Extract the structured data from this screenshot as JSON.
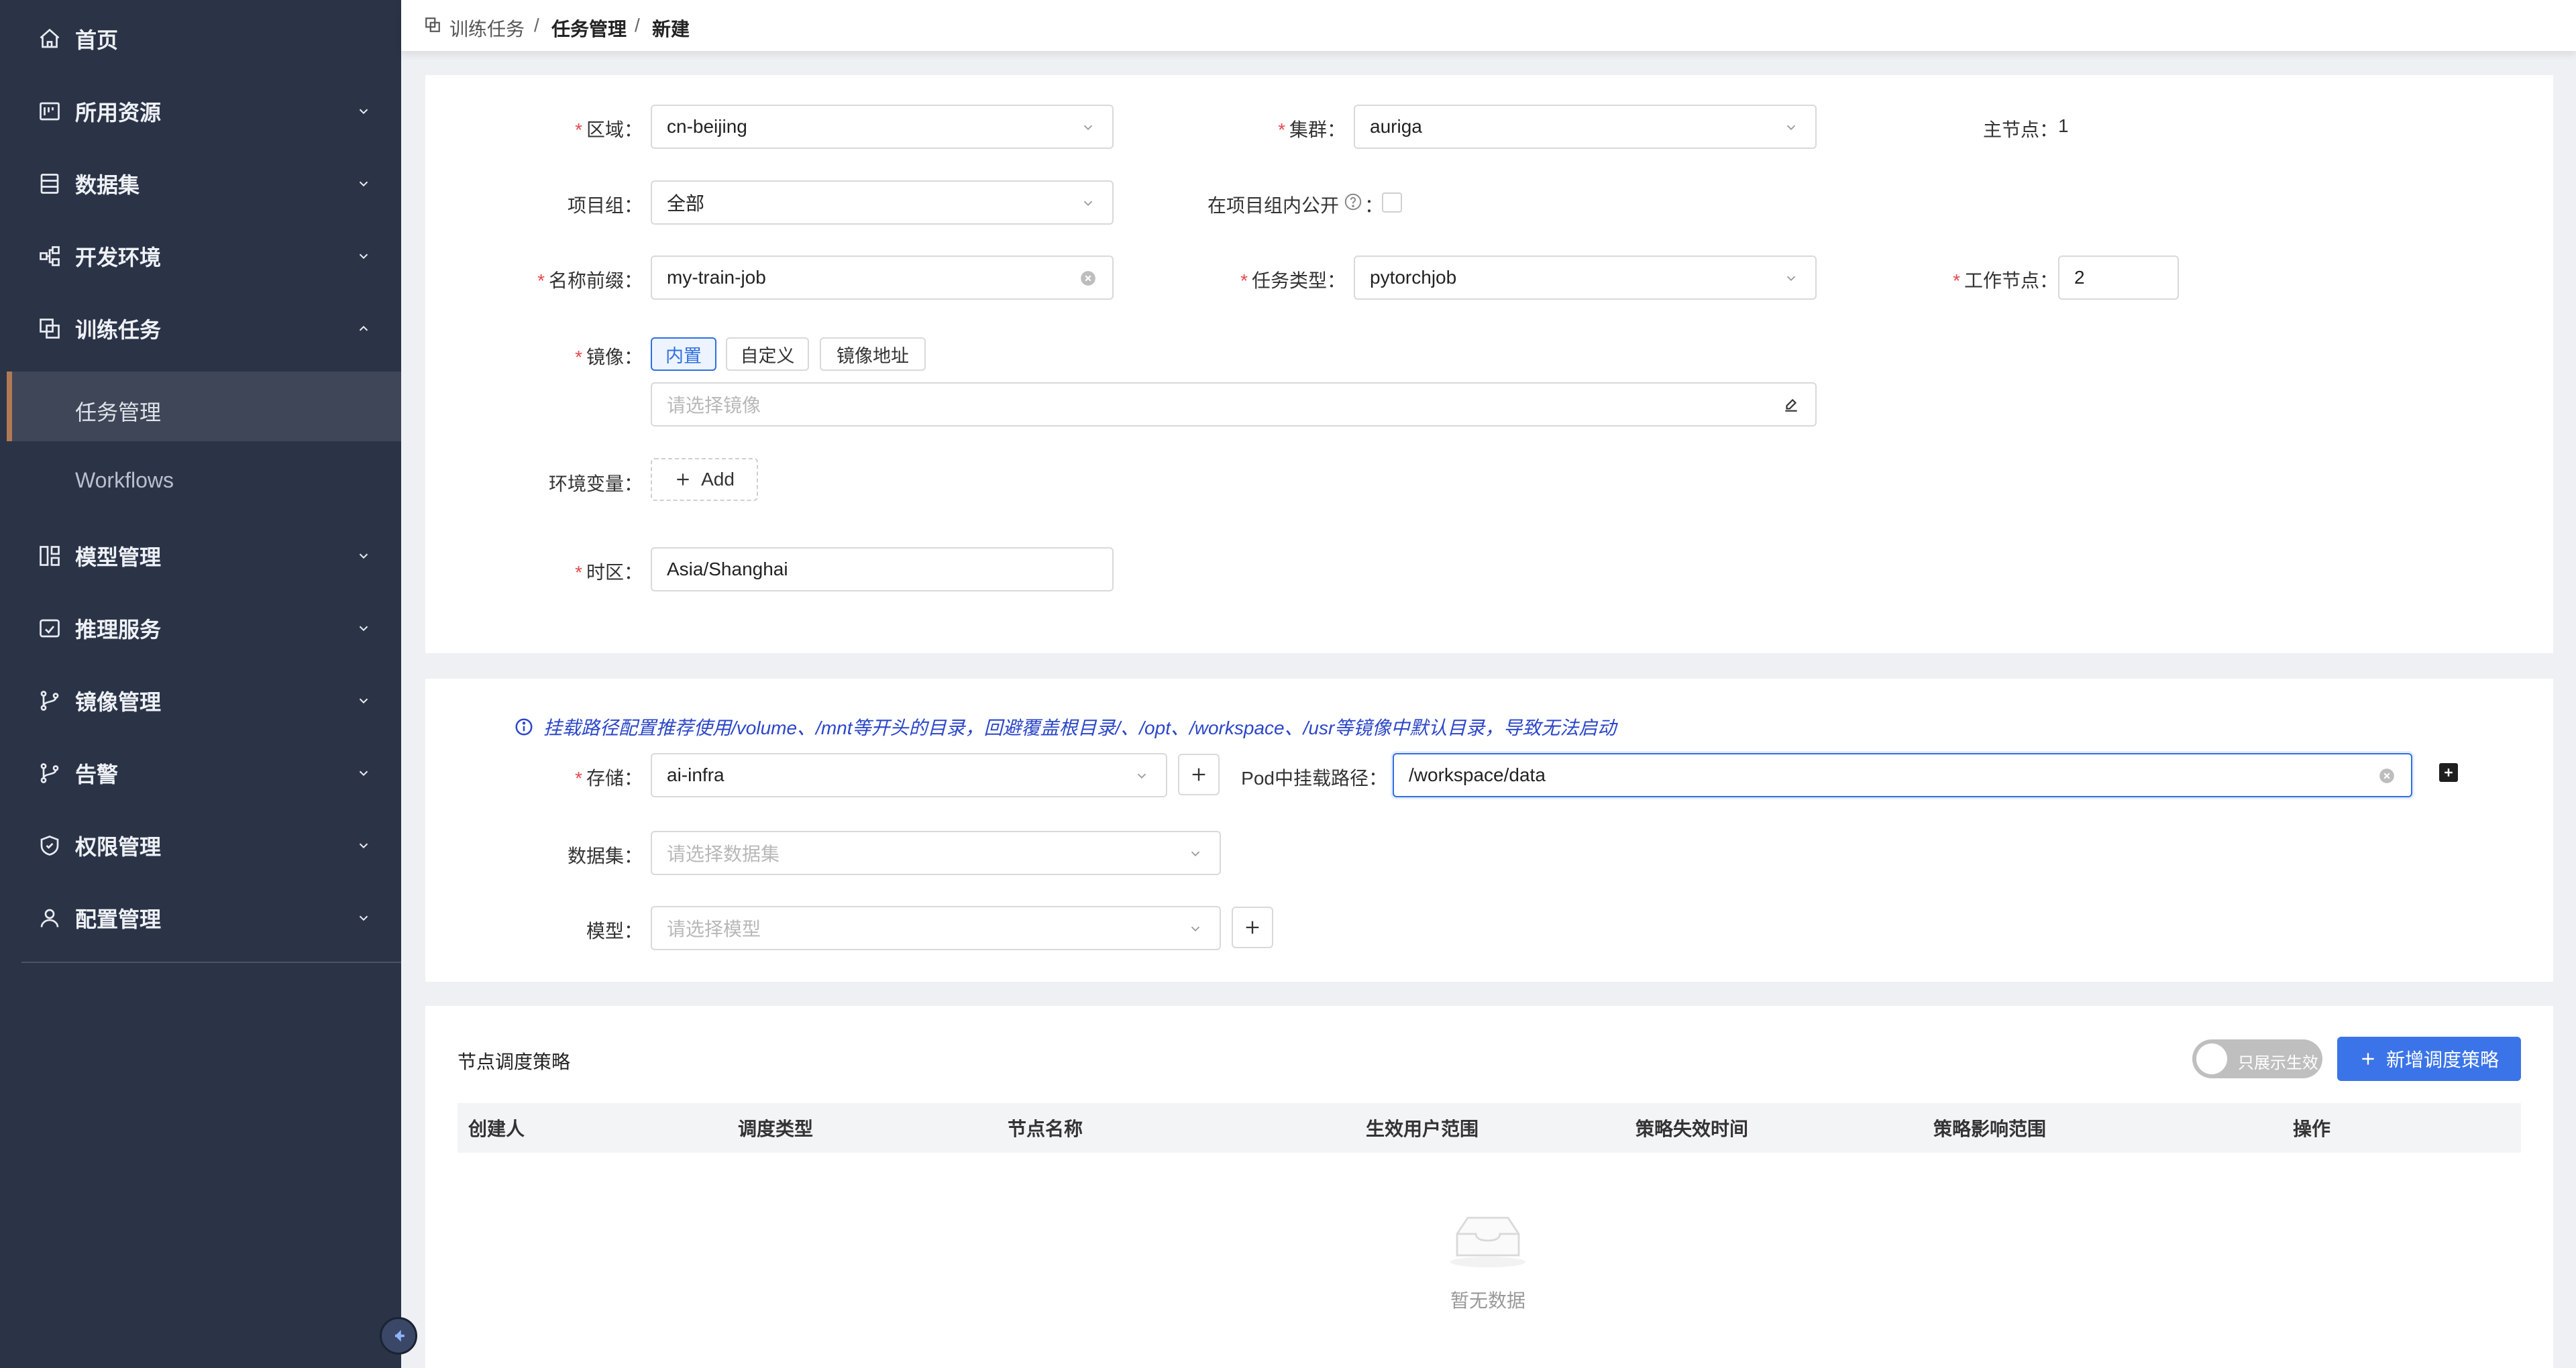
{
  "sidebar": {
    "items": [
      {
        "label": "首页"
      },
      {
        "label": "所用资源"
      },
      {
        "label": "数据集"
      },
      {
        "label": "开发环境"
      },
      {
        "label": "训练任务"
      },
      {
        "label": "模型管理"
      },
      {
        "label": "推理服务"
      },
      {
        "label": "镜像管理"
      },
      {
        "label": "告警"
      },
      {
        "label": "权限管理"
      },
      {
        "label": "配置管理"
      }
    ],
    "sub_items": [
      {
        "label": "任务管理"
      },
      {
        "label": "Workflows"
      }
    ]
  },
  "breadcrumb": {
    "items": [
      "训练任务",
      "任务管理",
      "新建"
    ],
    "separator": "/"
  },
  "basic_form": {
    "region": {
      "label": "区域",
      "value": "cn-beijing"
    },
    "cluster": {
      "label": "集群",
      "value": "auriga"
    },
    "master_node": {
      "label": "主节点",
      "value": "1"
    },
    "project_group": {
      "label": "项目组",
      "value": "全部"
    },
    "public_in_group": {
      "label": "在项目组内公开"
    },
    "name_prefix": {
      "label": "名称前缀",
      "value": "my-train-job"
    },
    "task_type": {
      "label": "任务类型",
      "value": "pytorchjob"
    },
    "worker_nodes": {
      "label": "工作节点",
      "value": "2"
    },
    "image": {
      "label": "镜像",
      "options": [
        "内置",
        "自定义",
        "镜像地址"
      ],
      "placeholder": "请选择镜像"
    },
    "env_vars": {
      "label": "环境变量",
      "add_label": "Add"
    },
    "timezone": {
      "label": "时区",
      "value": "Asia/Shanghai"
    }
  },
  "mount_form": {
    "notice": "挂载路径配置推荐使用/volume、/mnt等开头的目录，回避覆盖根目录/、/opt、/workspace、/usr等镜像中默认目录，导致无法启动",
    "storage": {
      "label": "存储",
      "value": "ai-infra"
    },
    "pod_mount_path": {
      "label": "Pod中挂载路径",
      "value": "/workspace/data"
    },
    "dataset": {
      "label": "数据集",
      "placeholder": "请选择数据集"
    },
    "model": {
      "label": "模型",
      "placeholder": "请选择模型"
    }
  },
  "scheduling": {
    "title": "节点调度策略",
    "toggle_label": "只展示生效",
    "add_button": "新增调度策略",
    "columns": [
      "创建人",
      "调度类型",
      "节点名称",
      "生效用户范围",
      "策略失效时间",
      "策略影响范围",
      "操作"
    ],
    "empty_text": "暂无数据"
  },
  "colors": {
    "sidebar_bg": "#2b3347",
    "primary": "#2f6fe0",
    "required": "#e5484d",
    "active_marker": "#b07a55"
  }
}
